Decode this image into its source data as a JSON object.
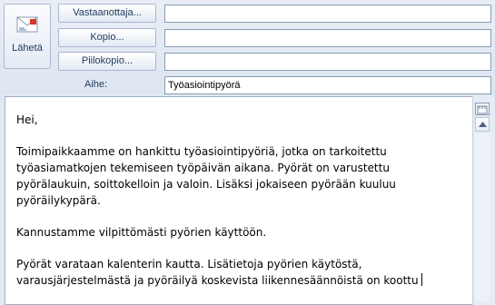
{
  "toolbar": {
    "send_label": "Lähetä"
  },
  "recipients": {
    "to_label": "Vastaanottaja...",
    "to_value": "",
    "cc_label": "Kopio...",
    "cc_value": "",
    "bcc_label": "Piilokopio...",
    "bcc_value": ""
  },
  "subject": {
    "label": "Aihe:",
    "value": "Työasiointipyörä"
  },
  "message": {
    "greeting": "Hei,",
    "paragraph1": "Toimipaikkaamme on hankittu työasiointipyöriä, jotka on tarkoitettu työasiamatkojen tekemiseen työpäivän aikana. Pyörät on varustettu pyörälaukuin, soittokelloin ja valoin. Lisäksi jokaiseen pyörään kuuluu pyöräilykypärä.",
    "paragraph2": "Kannustamme vilpittömästi pyörien käyttöön.",
    "paragraph3": "Pyörät varataan kalenterin kautta. Lisätietoja pyörien käytöstä, varausjärjestelmästä ja pyöräilyä koskevista liikennesäännöistä on koottu"
  },
  "icons": {
    "send": "envelope-send-icon",
    "ruler": "ruler-toggle-icon",
    "scroll_up": "scroll-up-arrow-icon"
  }
}
